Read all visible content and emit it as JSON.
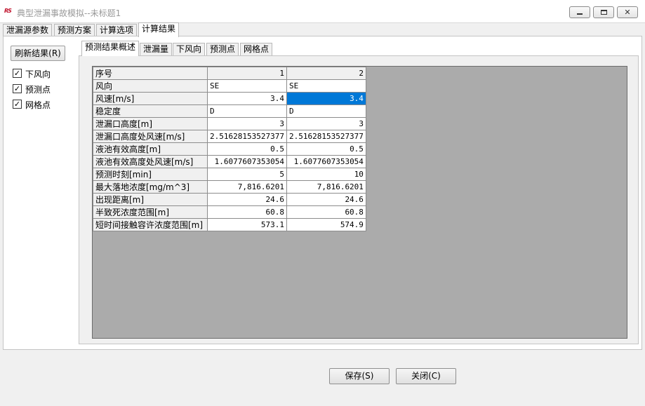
{
  "window": {
    "icon_text": "RS",
    "title": "典型泄漏事故模拟--未标题1",
    "close_glyph": "✕"
  },
  "top_tabs": [
    "泄漏源参数",
    "预测方案",
    "计算选项",
    "计算结果"
  ],
  "active_top_tab": "计算结果",
  "refresh_button": "刷新结果(R)",
  "checkboxes": [
    {
      "label": "下风向",
      "checked": true
    },
    {
      "label": "预测点",
      "checked": true
    },
    {
      "label": "网格点",
      "checked": true
    }
  ],
  "check_glyph": "✓",
  "sub_tabs": [
    "预测结果概述",
    "泄漏量",
    "下风向",
    "预测点",
    "网格点"
  ],
  "active_sub_tab": "预测结果概述",
  "grid": {
    "header": {
      "label": "序号",
      "cols": [
        "1",
        "2"
      ]
    },
    "rows": [
      {
        "label": "风向",
        "v1": "SE",
        "v2": "SE"
      },
      {
        "label": "风速[m/s]",
        "v1": "3.4",
        "v2": "3.4"
      },
      {
        "label": "稳定度",
        "v1": "D",
        "v2": "D"
      },
      {
        "label": "泄漏口高度[m]",
        "v1": "3",
        "v2": "3"
      },
      {
        "label": "泄漏口高度处风速[m/s]",
        "v1": "2.51628153527377",
        "v2": "2.51628153527377"
      },
      {
        "label": "液池有效高度[m]",
        "v1": "0.5",
        "v2": "0.5"
      },
      {
        "label": "液池有效高度处风速[m/s]",
        "v1": "1.6077607353054",
        "v2": "1.6077607353054"
      },
      {
        "label": "预测时刻[min]",
        "v1": "5",
        "v2": "10"
      },
      {
        "label": "最大落地浓度[mg/m^3]",
        "v1": "7,816.6201",
        "v2": "7,816.6201"
      },
      {
        "label": "出现距离[m]",
        "v1": "24.6",
        "v2": "24.6"
      },
      {
        "label": "半致死浓度范围[m]",
        "v1": "60.8",
        "v2": "60.8"
      },
      {
        "label": "短时间接触容许浓度范围[m]",
        "v1": "573.1",
        "v2": "574.9"
      }
    ],
    "selected_cell": "风速[m/s] / 2"
  },
  "buttons": {
    "save": "保存(S)",
    "close": "关闭(C)"
  }
}
